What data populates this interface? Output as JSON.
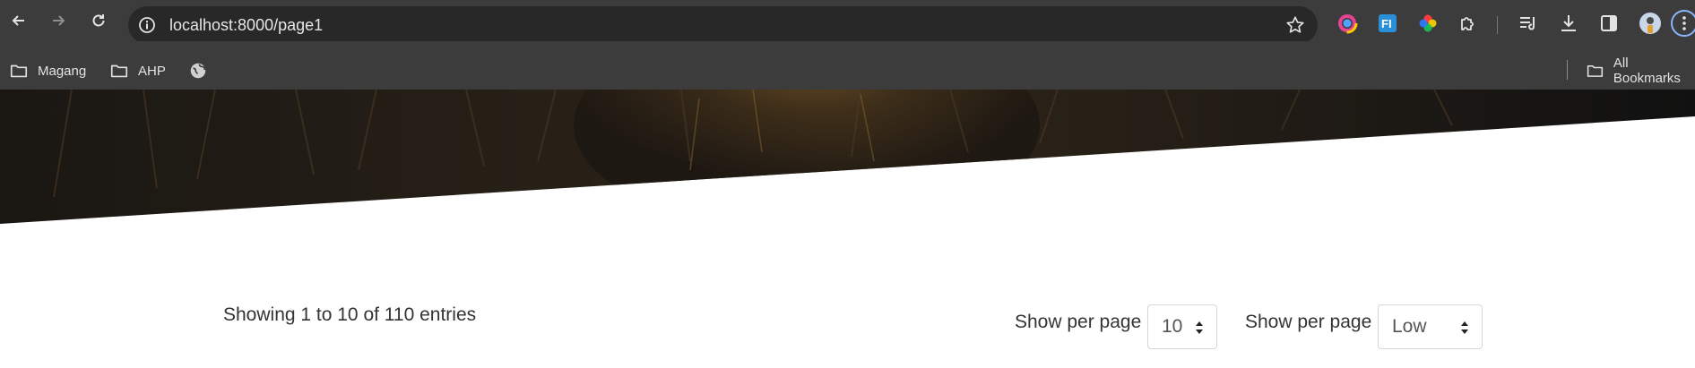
{
  "browser": {
    "url": "localhost:8000/page1",
    "bookmarks": [
      {
        "label": "Magang",
        "icon": "folder-icon"
      },
      {
        "label": "AHP",
        "icon": "folder-icon"
      },
      {
        "label": "",
        "icon": "globe-icon"
      }
    ],
    "all_bookmarks_label": "All Bookmarks",
    "extensions": [
      "color-picker-icon",
      "fi-extension-icon",
      "color-wheel-icon",
      "puzzle-icon"
    ]
  },
  "page": {
    "entries_info": "Showing 1 to 10 of 110 entries",
    "per_page": {
      "label": "Show per page",
      "value": "10"
    },
    "sort": {
      "label": "Show per page",
      "value": "Low"
    }
  },
  "colors": {
    "chrome_bg": "#3c3c3c",
    "omnibox_bg": "#282828",
    "hero_dark": "#1b1611",
    "hero_light": "#6a4f26",
    "text": "#333333"
  }
}
